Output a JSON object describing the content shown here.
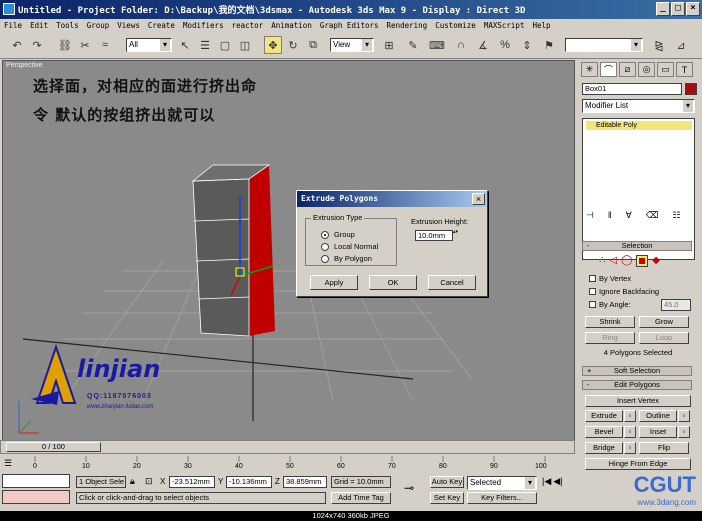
{
  "titlebar": {
    "title": "Untitled     - Project Folder: D:\\Backup\\我的文档\\3dsmax     - Autodesk 3ds Max 9     - Display : Direct 3D"
  },
  "menu": [
    "File",
    "Edit",
    "Tools",
    "Group",
    "Views",
    "Create",
    "Modifiers",
    "reactor",
    "Animation",
    "Graph Editors",
    "Rendering",
    "Customize",
    "MAXScript",
    "Help"
  ],
  "toolbar": {
    "selection_filter": "All",
    "ref_coord": "View"
  },
  "viewport": {
    "label": "Perspective",
    "instruction_line1": "选择面，对相应的面进行挤出命",
    "instruction_line2": "令 默认的按组挤出就可以"
  },
  "dialog": {
    "title": "Extrude Polygons",
    "extrusion_type_label": "Extrusion Type",
    "options": [
      "Group",
      "Local Normal",
      "By Polygon"
    ],
    "selected_option": "Group",
    "extrusion_height_label": "Extrusion Height:",
    "extrusion_height_value": "10.0mm",
    "apply_label": "Apply",
    "ok_label": "OK",
    "cancel_label": "Cancel"
  },
  "command_panel": {
    "object_name": "Box01",
    "modifier_list": "Modifier List",
    "stack_item": "Editable Poly",
    "selection_header": "Selection",
    "by_vertex": "By Vertex",
    "ignore_backfacing": "Ignore Backfacing",
    "by_angle": "By Angle:",
    "by_angle_value": "45.0",
    "shrink": "Shrink",
    "grow": "Grow",
    "ring": "Ring",
    "loop": "Loop",
    "selection_status": "4 Polygons Selected",
    "soft_selection": "Soft Selection",
    "edit_polygons": "Edit Polygons",
    "insert_vertex": "Insert Vertex",
    "extrude": "Extrude",
    "outline": "Outline",
    "bevel": "Bevel",
    "inset": "Inset",
    "bridge": "Bridge",
    "flip": "Flip",
    "hinge_from_edge": "Hinge From Edge",
    "accent_color": "#a70d10"
  },
  "timeline": {
    "frame_indicator": "0 / 100",
    "ticks": [
      "0",
      "10",
      "20",
      "30",
      "40",
      "50",
      "60",
      "70",
      "80",
      "90",
      "100"
    ]
  },
  "status": {
    "selection_count": "1 Object Sele",
    "x_value": "-23.512mm",
    "y_value": "-10.136mm",
    "z_value": "38.859mm",
    "grid": "Grid = 10.0mm",
    "prompt": "Click or click-and-drag to select objects",
    "add_time_tag": "Add Time Tag",
    "auto_key": "Auto Key",
    "set_key": "Set Key",
    "key_mode": "Selected",
    "key_filters": "Key Filters..."
  },
  "watermark": {
    "logo_text": "linjian",
    "logo_sub": "QQ:1187076003",
    "logo_url": "www.zhanjian.fudao.com",
    "brand": "CGUT",
    "brand_url": "www.3dang.com"
  },
  "footer": {
    "caption": "1024x740  360kb  JPEG"
  }
}
